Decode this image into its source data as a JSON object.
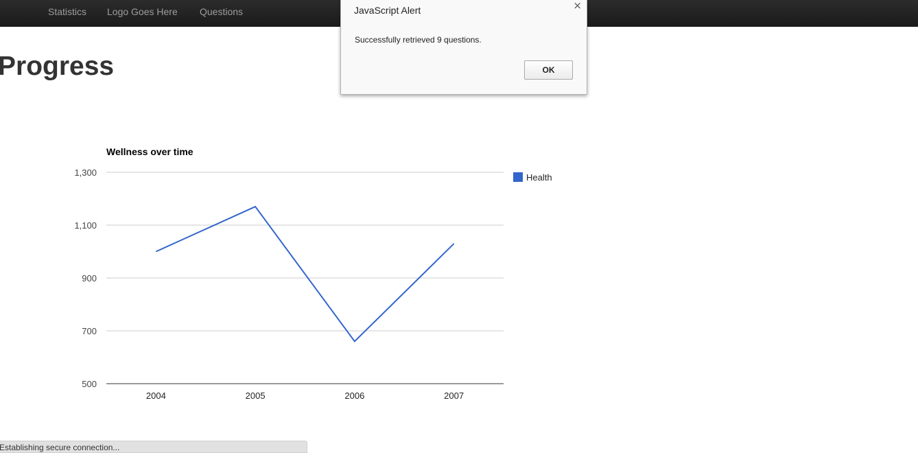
{
  "navbar": {
    "items": [
      {
        "label": "Statistics"
      },
      {
        "label": "Logo Goes Here"
      },
      {
        "label": "Questions"
      }
    ]
  },
  "page": {
    "title": "Progress"
  },
  "chart_data": {
    "type": "line",
    "title": "Wellness over time",
    "categories": [
      "2004",
      "2005",
      "2006",
      "2007"
    ],
    "series": [
      {
        "name": "Health",
        "values": [
          1000,
          1170,
          660,
          1030
        ],
        "color": "#3366cc"
      }
    ],
    "ylim": [
      500,
      1300
    ],
    "yticks": [
      500,
      700,
      900,
      1100,
      1300
    ],
    "ytick_labels": [
      "500",
      "700",
      "900",
      "1,100",
      "1,300"
    ],
    "grid": true,
    "legend": "right"
  },
  "alert": {
    "title": "JavaScript Alert",
    "close_icon": "×",
    "message": "Successfully retrieved 9 questions.",
    "ok_label": "OK"
  },
  "statusbar": {
    "text": "Establishing secure connection..."
  }
}
